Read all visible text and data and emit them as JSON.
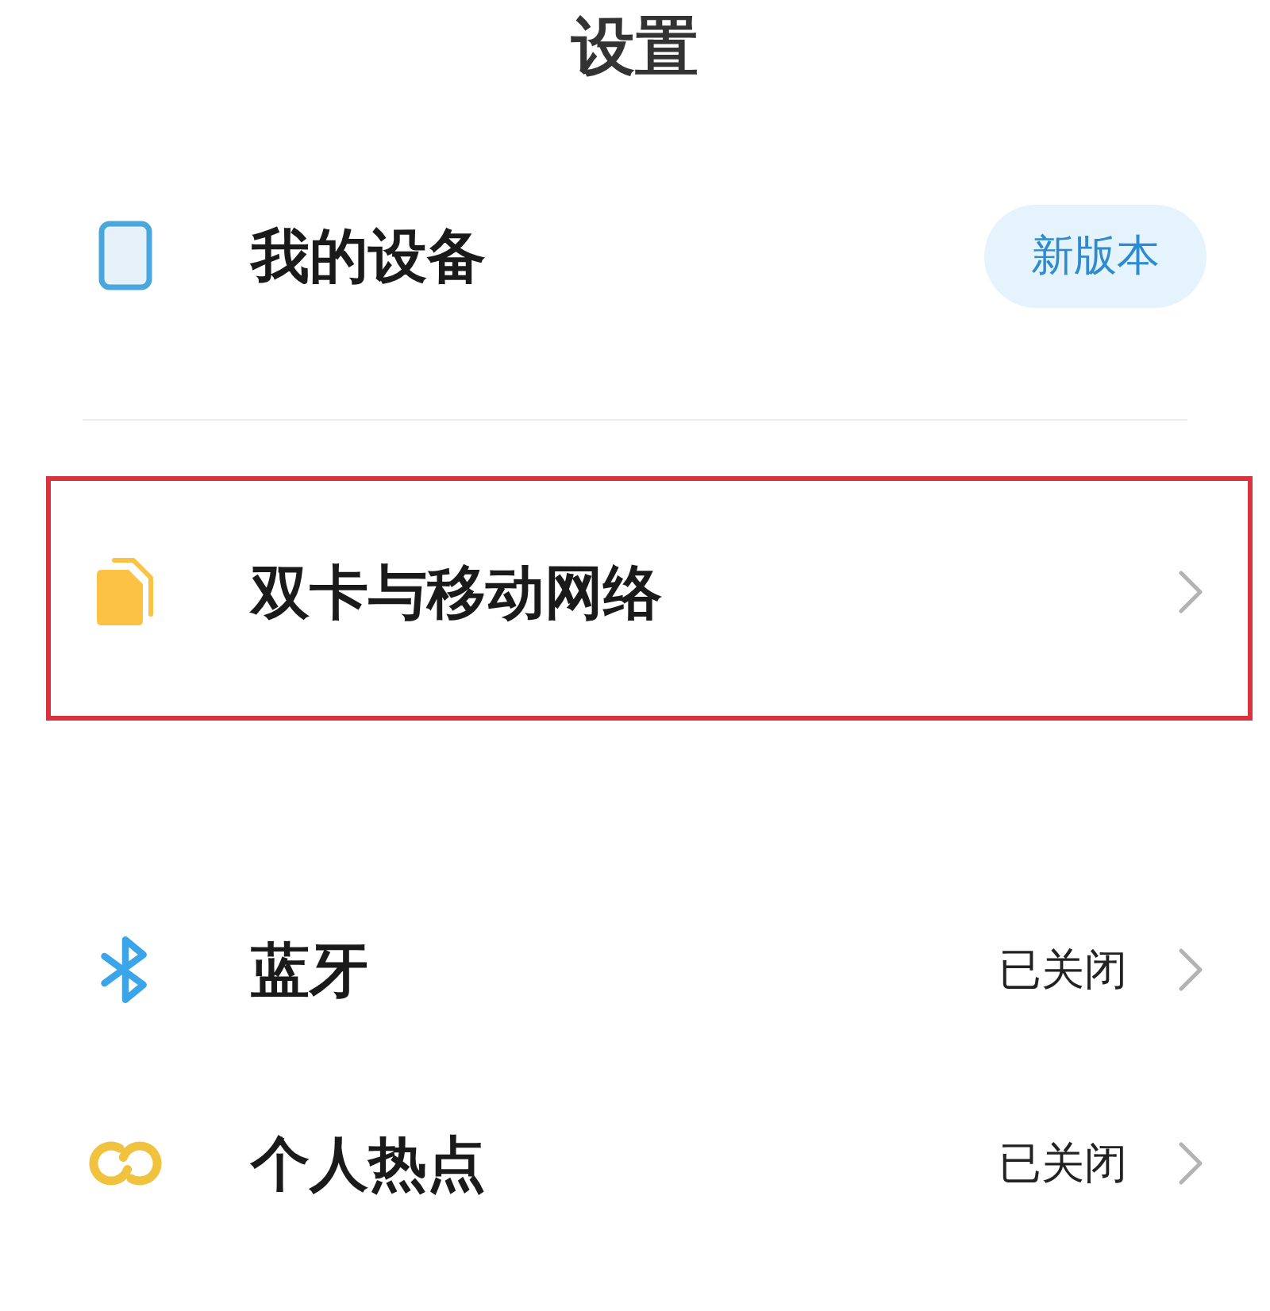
{
  "title": "设置",
  "sections": [
    {
      "items": [
        {
          "kind": "badge",
          "label": "我的设备",
          "badge": "新版本",
          "highlighted": false
        }
      ]
    },
    {
      "items": [
        {
          "kind": "nav",
          "label": "双卡与移动网络",
          "highlighted": true
        }
      ]
    },
    {
      "items": [
        {
          "kind": "nav",
          "label": "蓝牙",
          "status": "已关闭",
          "highlighted": false
        },
        {
          "kind": "nav",
          "label": "个人热点",
          "status": "已关闭",
          "highlighted": false
        }
      ]
    }
  ]
}
